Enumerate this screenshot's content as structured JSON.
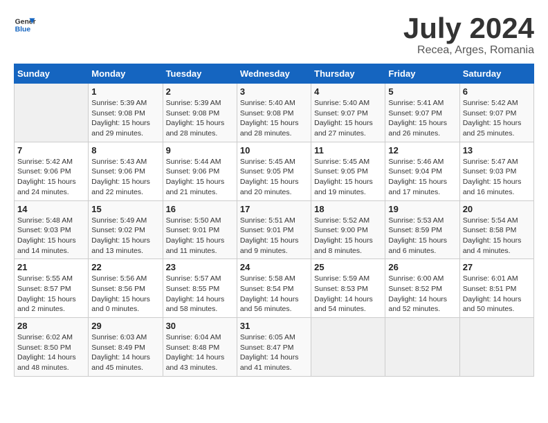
{
  "header": {
    "logo_general": "General",
    "logo_blue": "Blue",
    "month": "July 2024",
    "location": "Recea, Arges, Romania"
  },
  "weekdays": [
    "Sunday",
    "Monday",
    "Tuesday",
    "Wednesday",
    "Thursday",
    "Friday",
    "Saturday"
  ],
  "weeks": [
    [
      {
        "day": "",
        "info": ""
      },
      {
        "day": "1",
        "info": "Sunrise: 5:39 AM\nSunset: 9:08 PM\nDaylight: 15 hours\nand 29 minutes."
      },
      {
        "day": "2",
        "info": "Sunrise: 5:39 AM\nSunset: 9:08 PM\nDaylight: 15 hours\nand 28 minutes."
      },
      {
        "day": "3",
        "info": "Sunrise: 5:40 AM\nSunset: 9:08 PM\nDaylight: 15 hours\nand 28 minutes."
      },
      {
        "day": "4",
        "info": "Sunrise: 5:40 AM\nSunset: 9:07 PM\nDaylight: 15 hours\nand 27 minutes."
      },
      {
        "day": "5",
        "info": "Sunrise: 5:41 AM\nSunset: 9:07 PM\nDaylight: 15 hours\nand 26 minutes."
      },
      {
        "day": "6",
        "info": "Sunrise: 5:42 AM\nSunset: 9:07 PM\nDaylight: 15 hours\nand 25 minutes."
      }
    ],
    [
      {
        "day": "7",
        "info": "Sunrise: 5:42 AM\nSunset: 9:06 PM\nDaylight: 15 hours\nand 24 minutes."
      },
      {
        "day": "8",
        "info": "Sunrise: 5:43 AM\nSunset: 9:06 PM\nDaylight: 15 hours\nand 22 minutes."
      },
      {
        "day": "9",
        "info": "Sunrise: 5:44 AM\nSunset: 9:06 PM\nDaylight: 15 hours\nand 21 minutes."
      },
      {
        "day": "10",
        "info": "Sunrise: 5:45 AM\nSunset: 9:05 PM\nDaylight: 15 hours\nand 20 minutes."
      },
      {
        "day": "11",
        "info": "Sunrise: 5:45 AM\nSunset: 9:05 PM\nDaylight: 15 hours\nand 19 minutes."
      },
      {
        "day": "12",
        "info": "Sunrise: 5:46 AM\nSunset: 9:04 PM\nDaylight: 15 hours\nand 17 minutes."
      },
      {
        "day": "13",
        "info": "Sunrise: 5:47 AM\nSunset: 9:03 PM\nDaylight: 15 hours\nand 16 minutes."
      }
    ],
    [
      {
        "day": "14",
        "info": "Sunrise: 5:48 AM\nSunset: 9:03 PM\nDaylight: 15 hours\nand 14 minutes."
      },
      {
        "day": "15",
        "info": "Sunrise: 5:49 AM\nSunset: 9:02 PM\nDaylight: 15 hours\nand 13 minutes."
      },
      {
        "day": "16",
        "info": "Sunrise: 5:50 AM\nSunset: 9:01 PM\nDaylight: 15 hours\nand 11 minutes."
      },
      {
        "day": "17",
        "info": "Sunrise: 5:51 AM\nSunset: 9:01 PM\nDaylight: 15 hours\nand 9 minutes."
      },
      {
        "day": "18",
        "info": "Sunrise: 5:52 AM\nSunset: 9:00 PM\nDaylight: 15 hours\nand 8 minutes."
      },
      {
        "day": "19",
        "info": "Sunrise: 5:53 AM\nSunset: 8:59 PM\nDaylight: 15 hours\nand 6 minutes."
      },
      {
        "day": "20",
        "info": "Sunrise: 5:54 AM\nSunset: 8:58 PM\nDaylight: 15 hours\nand 4 minutes."
      }
    ],
    [
      {
        "day": "21",
        "info": "Sunrise: 5:55 AM\nSunset: 8:57 PM\nDaylight: 15 hours\nand 2 minutes."
      },
      {
        "day": "22",
        "info": "Sunrise: 5:56 AM\nSunset: 8:56 PM\nDaylight: 15 hours\nand 0 minutes."
      },
      {
        "day": "23",
        "info": "Sunrise: 5:57 AM\nSunset: 8:55 PM\nDaylight: 14 hours\nand 58 minutes."
      },
      {
        "day": "24",
        "info": "Sunrise: 5:58 AM\nSunset: 8:54 PM\nDaylight: 14 hours\nand 56 minutes."
      },
      {
        "day": "25",
        "info": "Sunrise: 5:59 AM\nSunset: 8:53 PM\nDaylight: 14 hours\nand 54 minutes."
      },
      {
        "day": "26",
        "info": "Sunrise: 6:00 AM\nSunset: 8:52 PM\nDaylight: 14 hours\nand 52 minutes."
      },
      {
        "day": "27",
        "info": "Sunrise: 6:01 AM\nSunset: 8:51 PM\nDaylight: 14 hours\nand 50 minutes."
      }
    ],
    [
      {
        "day": "28",
        "info": "Sunrise: 6:02 AM\nSunset: 8:50 PM\nDaylight: 14 hours\nand 48 minutes."
      },
      {
        "day": "29",
        "info": "Sunrise: 6:03 AM\nSunset: 8:49 PM\nDaylight: 14 hours\nand 45 minutes."
      },
      {
        "day": "30",
        "info": "Sunrise: 6:04 AM\nSunset: 8:48 PM\nDaylight: 14 hours\nand 43 minutes."
      },
      {
        "day": "31",
        "info": "Sunrise: 6:05 AM\nSunset: 8:47 PM\nDaylight: 14 hours\nand 41 minutes."
      },
      {
        "day": "",
        "info": ""
      },
      {
        "day": "",
        "info": ""
      },
      {
        "day": "",
        "info": ""
      }
    ]
  ]
}
